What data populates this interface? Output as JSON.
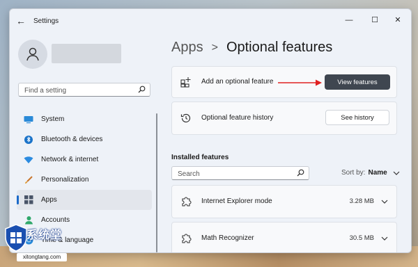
{
  "window": {
    "title": "Settings",
    "controls": {
      "minimize": "—",
      "maximize": "☐",
      "close": "✕"
    }
  },
  "sidebar": {
    "search_placeholder": "Find a setting",
    "items": [
      {
        "label": "System",
        "icon": "monitor-icon",
        "active": false
      },
      {
        "label": "Bluetooth & devices",
        "icon": "bluetooth-icon",
        "active": false
      },
      {
        "label": "Network & internet",
        "icon": "wifi-icon",
        "active": false
      },
      {
        "label": "Personalization",
        "icon": "brush-icon",
        "active": false
      },
      {
        "label": "Apps",
        "icon": "apps-icon",
        "active": true
      },
      {
        "label": "Accounts",
        "icon": "accounts-icon",
        "active": false
      },
      {
        "label": "Time & language",
        "icon": "globe-icon",
        "active": false
      }
    ]
  },
  "breadcrumb": {
    "parent": "Apps",
    "separator": ">",
    "current": "Optional features"
  },
  "add_feature": {
    "label": "Add an optional feature",
    "button": "View features"
  },
  "history": {
    "label": "Optional feature history",
    "button": "See history"
  },
  "installed": {
    "title": "Installed features",
    "search_placeholder": "Search",
    "sort_label": "Sort by:",
    "sort_value": "Name",
    "features": [
      {
        "name": "Internet Explorer mode",
        "size": "3.28 MB"
      },
      {
        "name": "Math Recognizer",
        "size": "30.5 MB"
      }
    ]
  },
  "colors": {
    "accent": "#1b6ac9",
    "primary_button": "#3f4650",
    "arrow": "#e02020"
  },
  "watermark": {
    "text": "系统堂",
    "url": "xitongtang.com"
  }
}
